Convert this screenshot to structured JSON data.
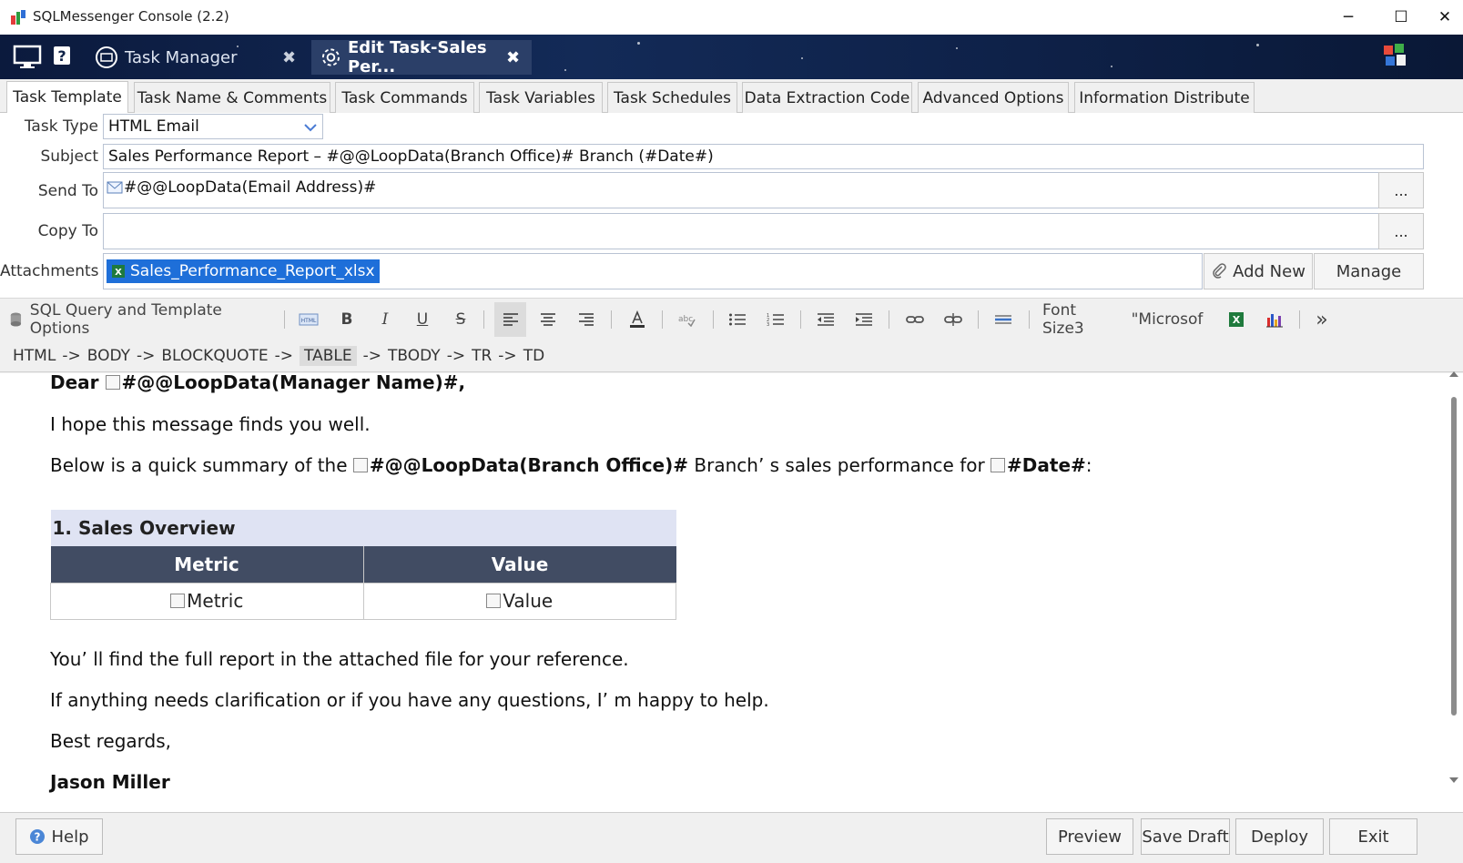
{
  "window": {
    "title": "SQLMessenger Console (2.2)",
    "minimize": "─",
    "maximize": "☐",
    "close": "✕"
  },
  "dark_tabs": [
    {
      "label": "Task Manager",
      "close": "✖"
    },
    {
      "label": "Edit Task-Sales Per...",
      "close": "✖"
    }
  ],
  "tabs": [
    "Task Template",
    "Task Name & Comments",
    "Task Commands",
    "Task Variables",
    "Task Schedules",
    "Data Extraction Code",
    "Advanced Options",
    "Information Distribute"
  ],
  "form": {
    "task_type_label": "Task Type",
    "task_type_value": "HTML Email",
    "subject_label": "Subject",
    "subject_value": "Sales Performance Report – #@@LoopData(Branch Office)# Branch (#Date#)",
    "send_to_label": "Send To",
    "send_to_value": "#@@LoopData(Email Address)#",
    "copy_to_label": "Copy To",
    "copy_to_value": "",
    "ellipsis": "...",
    "attachments_label": "Attachments",
    "attachment_value": "Sales_Performance_Report_xlsx",
    "add_new_label": "Add New",
    "manage_label": "Manage"
  },
  "format_bar": {
    "sql_options": "SQL Query and Template Options",
    "bold": "B",
    "italic": "I",
    "underline": "U",
    "strike": "S",
    "font_size": "Font Size3",
    "font_name": "\"Microsof",
    "more": "»"
  },
  "path": [
    "HTML",
    "BODY",
    "BLOCKQUOTE",
    "TABLE",
    "TBODY",
    "TR",
    "TD"
  ],
  "path_sep": "->",
  "editor": {
    "dear": "Dear",
    "manager_placeholder": "#@@LoopData(Manager Name)#,",
    "line1": "I hope this message finds you well.",
    "line2_pre": "Below is a quick summary of the",
    "branch_placeholder": "#@@LoopData(Branch Office)#",
    "line2_mid": "Branch’ s sales performance for",
    "date_placeholder": "#Date#",
    "line2_post": ":",
    "table_title": "1. Sales Overview",
    "col_metric": "Metric",
    "col_value": "Value",
    "cell_metric": "Metric",
    "cell_value": "Value",
    "line3": "You’ ll find the full report in the attached file for your reference.",
    "line4": "If anything needs clarification or if you have any questions, I’ m happy to help.",
    "line5": "Best regards,",
    "signature": "Jason Miller"
  },
  "footer": {
    "help": "Help",
    "preview": "Preview",
    "save_draft": "Save Draft",
    "deploy": "Deploy",
    "exit": "Exit"
  },
  "colors": {
    "header_dark": "#0f2248",
    "table_title_bg": "#dfe3f3",
    "table_header_bg": "#414c63",
    "selection": "#1e6fd9"
  }
}
